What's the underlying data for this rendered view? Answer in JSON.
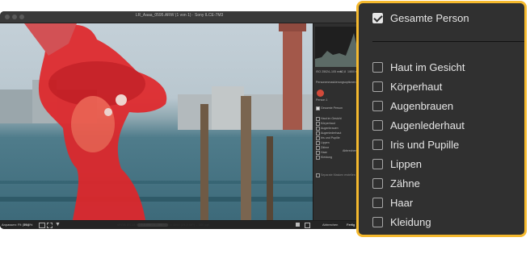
{
  "window": {
    "title": "LR_Aaaa_0595.ARW (1 von 1) · Sony ILCE-7M3"
  },
  "side_panel": {
    "histogram_values": [
      "ISO 250",
      "24–105 mm",
      "f/2,8",
      "1/800 s"
    ],
    "section_title": "Personenmaskierungsoptionen",
    "person_label": "Person 1",
    "whole_person_label": "Gesamte Person",
    "items": [
      "Haut im Gesicht",
      "Körperhaut",
      "Augenbrauen",
      "Augenlederhaut",
      "Iris und Pupille",
      "Lippen",
      "Zähne",
      "Haar",
      "Kleidung"
    ],
    "refine_label": "Abbrechen",
    "separate_label": "Separate Masken erstellen"
  },
  "bottom_bar": {
    "zoom_label": "Anpassen: Fit (0%)",
    "zoom_value": "36,8%",
    "file_info": "sRGB IEC61966-2.1 – 16 Bit – 6000 x 4000 (24,0 MP) – 300 ppi",
    "cancel_label": "Abbrechen",
    "done_label": "Fertig"
  },
  "callout": {
    "title_item": {
      "label": "Gesamte Person",
      "checked": true
    },
    "items": [
      {
        "label": "Haut im Gesicht",
        "checked": false
      },
      {
        "label": "Körperhaut",
        "checked": false
      },
      {
        "label": "Augenbrauen",
        "checked": false
      },
      {
        "label": "Augenlederhaut",
        "checked": false
      },
      {
        "label": "Iris und Pupille",
        "checked": false
      },
      {
        "label": "Lippen",
        "checked": false
      },
      {
        "label": "Zähne",
        "checked": false
      },
      {
        "label": "Haar",
        "checked": false
      },
      {
        "label": "Kleidung",
        "checked": false
      }
    ]
  },
  "colors": {
    "callout_border": "#f5b92e",
    "mask_overlay": "#e0262a",
    "panel_bg": "#303030"
  }
}
